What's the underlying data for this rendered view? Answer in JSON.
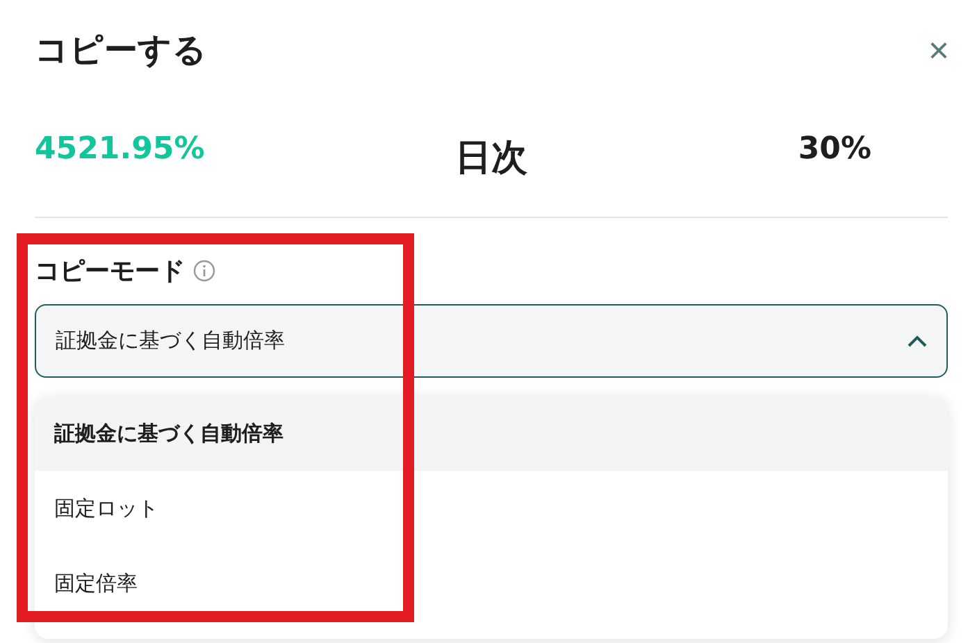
{
  "dialog": {
    "title": "コピーする",
    "close": "×"
  },
  "stats": [
    {
      "value": "4521.95%",
      "kind": "positive"
    },
    {
      "value": "日次",
      "kind": "plain"
    },
    {
      "value": "30%",
      "kind": "plain"
    }
  ],
  "copy_mode": {
    "label": "コピーモード",
    "value": "証拠金に基づく自動倍率",
    "expanded": true,
    "options": [
      {
        "label": "証拠金に基づく自動倍率",
        "selected": true
      },
      {
        "label": "固定ロット",
        "selected": false
      },
      {
        "label": "固定倍率",
        "selected": false
      }
    ]
  }
}
